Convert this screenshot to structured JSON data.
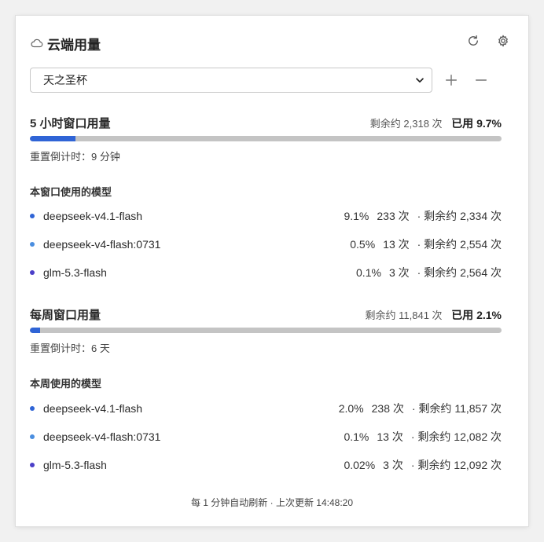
{
  "header": {
    "title": "云端用量",
    "cloud_icon": "cloud-icon",
    "refresh_icon": "refresh-icon",
    "settings_icon": "gear-icon"
  },
  "account_select": {
    "value": "天之圣杯",
    "add_icon": "plus-icon",
    "remove_icon": "minus-icon"
  },
  "five_hour": {
    "title": "5 小时窗口用量",
    "remaining": "剩余约 2,318 次",
    "used": "已用 9.7%",
    "used_fraction": 0.097,
    "reset": "重置倒计时：9 分钟",
    "models_title": "本窗口使用的模型",
    "models": [
      {
        "name": "deepseek-v4.1-flash",
        "pct": "9.1%",
        "count": "233 次",
        "remaining": "· 剩余约 2,334 次",
        "color": "#2f64d6"
      },
      {
        "name": "deepseek-v4-flash:0731",
        "pct": "0.5%",
        "count": "13 次",
        "remaining": "· 剩余约 2,554 次",
        "color": "#4a8ee0"
      },
      {
        "name": "glm-5.3-flash",
        "pct": "0.1%",
        "count": "3 次",
        "remaining": "· 剩余约 2,564 次",
        "color": "#4b3fc8"
      }
    ]
  },
  "weekly": {
    "title": "每周窗口用量",
    "remaining": "剩余约 11,841 次",
    "used": "已用 2.1%",
    "used_fraction": 0.021,
    "reset": "重置倒计时：6 天",
    "models_title": "本周使用的模型",
    "models": [
      {
        "name": "deepseek-v4.1-flash",
        "pct": "2.0%",
        "count": "238 次",
        "remaining": "· 剩余约 11,857 次",
        "color": "#2f64d6"
      },
      {
        "name": "deepseek-v4-flash:0731",
        "pct": "0.1%",
        "count": "13 次",
        "remaining": "· 剩余约 12,082 次",
        "color": "#4a8ee0"
      },
      {
        "name": "glm-5.3-flash",
        "pct": "0.02%",
        "count": "3 次",
        "remaining": "· 剩余约 12,092 次",
        "color": "#4b3fc8"
      }
    ]
  },
  "footer": {
    "text": "每 1 分钟自动刷新 · 上次更新 14:48:20"
  },
  "colors": {
    "accent": "#2f64d6",
    "track": "#c4c4c4"
  }
}
